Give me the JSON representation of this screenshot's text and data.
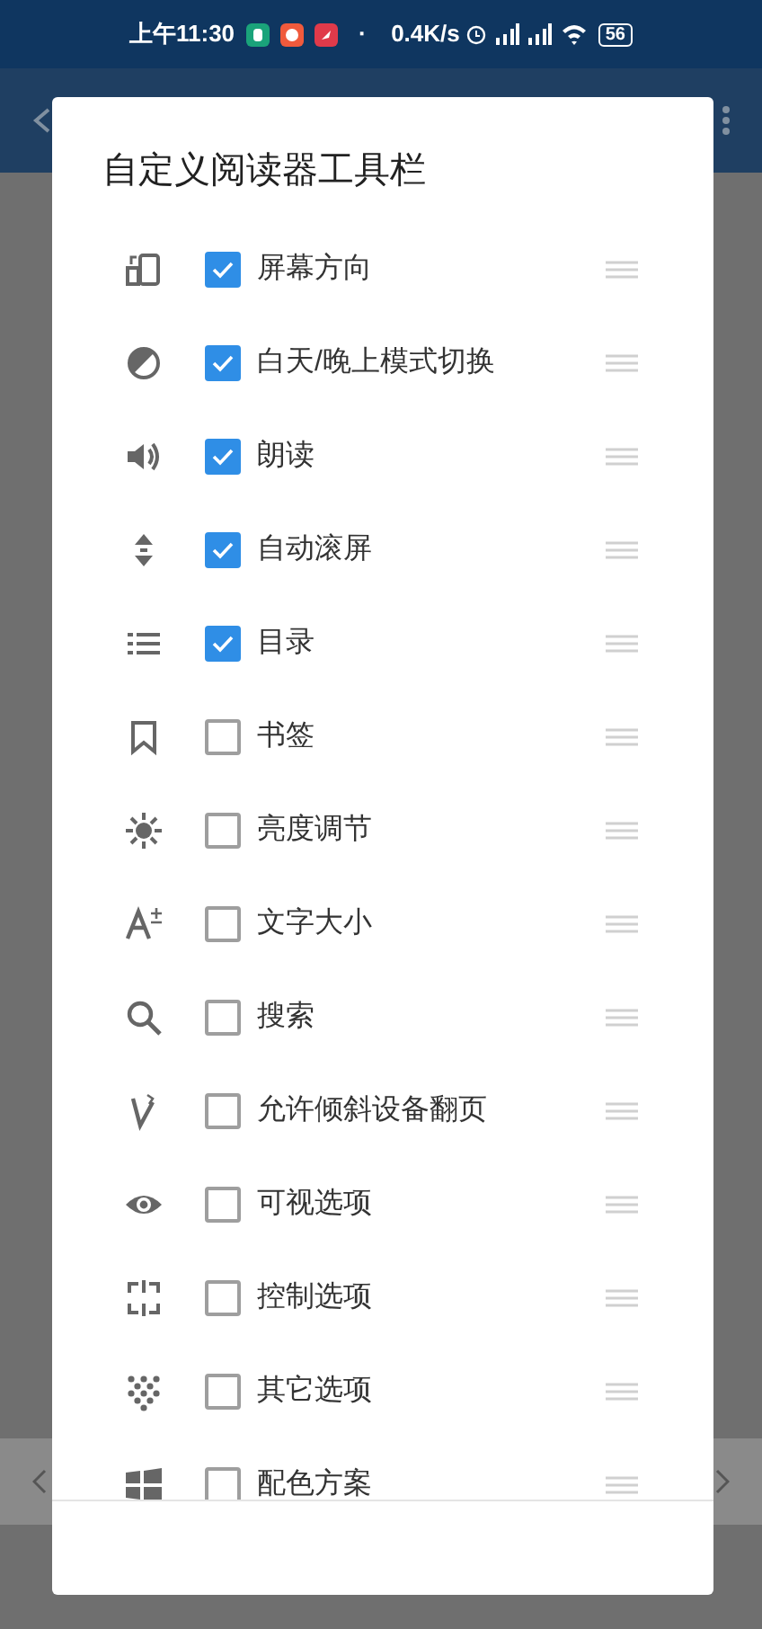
{
  "status_bar": {
    "time": "上午11:30",
    "dot": "·",
    "net_speed": "0.4K/s",
    "battery": "56"
  },
  "dialog": {
    "title": "自定义阅读器工具栏",
    "items": [
      {
        "label": "屏幕方向",
        "checked": true
      },
      {
        "label": "白天/晚上模式切换",
        "checked": true
      },
      {
        "label": "朗读",
        "checked": true
      },
      {
        "label": "自动滚屏",
        "checked": true
      },
      {
        "label": "目录",
        "checked": true
      },
      {
        "label": "书签",
        "checked": false
      },
      {
        "label": "亮度调节",
        "checked": false
      },
      {
        "label": "文字大小",
        "checked": false
      },
      {
        "label": "搜索",
        "checked": false
      },
      {
        "label": "允许倾斜设备翻页",
        "checked": false
      },
      {
        "label": "可视选项",
        "checked": false
      },
      {
        "label": "控制选项",
        "checked": false
      },
      {
        "label": "其它选项",
        "checked": false
      },
      {
        "label": "配色方案",
        "checked": false
      }
    ]
  }
}
